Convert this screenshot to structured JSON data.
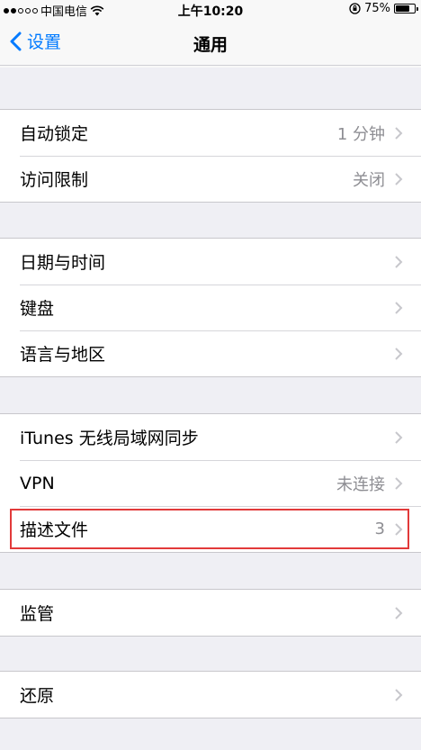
{
  "status_bar": {
    "carrier": "中国电信",
    "time": "上午10:20",
    "battery": "75%",
    "battery_level": 0.75,
    "signal_bars_filled": 2,
    "signal_bars_total": 5
  },
  "nav": {
    "back_label": "设置",
    "title": "通用"
  },
  "groups": [
    {
      "rows": [
        {
          "label": "自动锁定",
          "value": "1 分钟"
        },
        {
          "label": "访问限制",
          "value": "关闭"
        }
      ]
    },
    {
      "rows": [
        {
          "label": "日期与时间",
          "value": ""
        },
        {
          "label": "键盘",
          "value": ""
        },
        {
          "label": "语言与地区",
          "value": ""
        }
      ]
    },
    {
      "rows": [
        {
          "label": "iTunes 无线局域网同步",
          "value": ""
        },
        {
          "label": "VPN",
          "value": "未连接"
        },
        {
          "label": "描述文件",
          "value": "3"
        }
      ]
    },
    {
      "rows": [
        {
          "label": "监管",
          "value": ""
        }
      ]
    },
    {
      "rows": [
        {
          "label": "还原",
          "value": ""
        }
      ]
    }
  ],
  "colors": {
    "accent": "#007aff",
    "highlight": "#e23a3a",
    "background": "#efeff4"
  }
}
